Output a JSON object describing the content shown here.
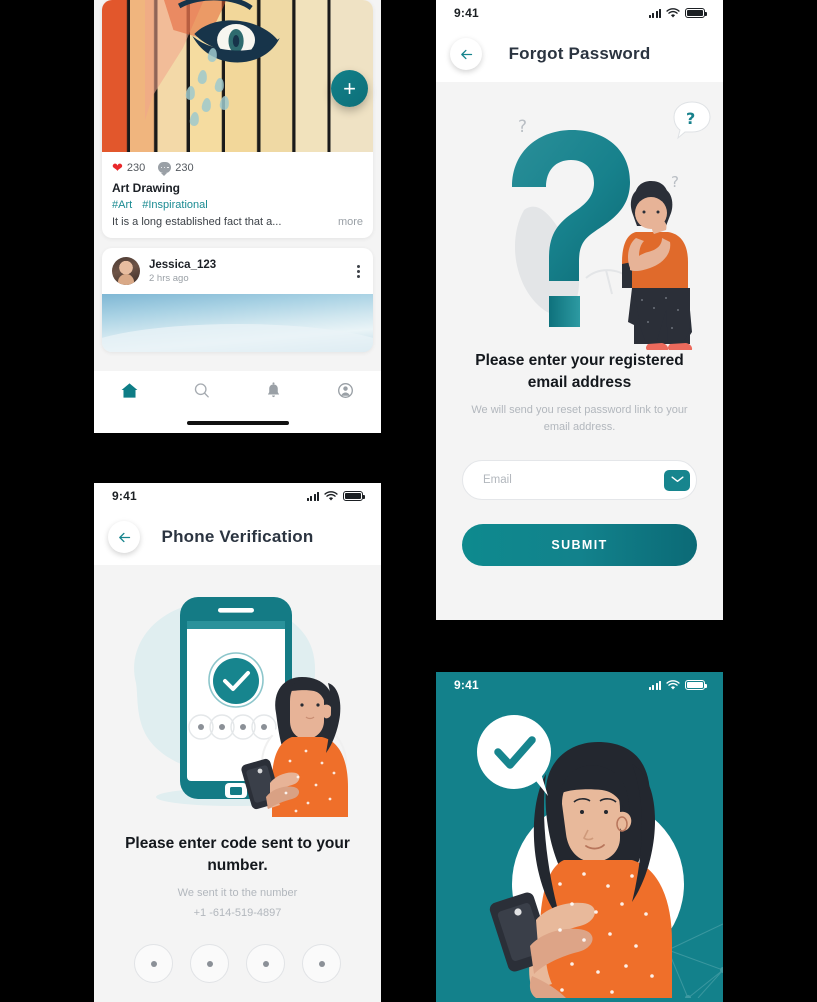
{
  "theme": {
    "teal": "#13818b",
    "teal_dark": "#0b6a76",
    "bg": "#f4f4f4",
    "heart": "#e9282b",
    "muted": "#b2b7bd"
  },
  "screens": {
    "feed": {
      "name": "social-feed",
      "post1": {
        "likes": "230",
        "comments": "230",
        "title": "Art Drawing",
        "tag1": "#Art",
        "tag2": "#Inspirational",
        "excerpt": "It is a long established fact that a...",
        "more_label": "more",
        "image_alt": "street-art-mural-on-wooden-fence"
      },
      "post2": {
        "username": "Jessica_123",
        "time": "2 hrs ago",
        "image_alt": "ocean-wave-photo"
      },
      "fab_label": "+",
      "nav": [
        {
          "icon": "home-icon",
          "active": true
        },
        {
          "icon": "search-icon",
          "active": false
        },
        {
          "icon": "bell-icon",
          "active": false
        },
        {
          "icon": "account-icon",
          "active": false
        }
      ]
    },
    "forgot": {
      "status": {
        "time": "9:41"
      },
      "title": "Forgot Password",
      "headline": "Please enter your registered email address",
      "subline": "We will send you reset password link to your email address.",
      "email_placeholder": "Email",
      "email_value": "",
      "submit_label": "SUBMIT",
      "illustration_alt": "woman-thinking-beside-large-question-mark"
    },
    "verify": {
      "status": {
        "time": "9:41"
      },
      "title": "Phone Verification",
      "headline": "Please enter code sent to your number.",
      "subline": "We sent it to the number",
      "phone": "+1 -614-519-4897",
      "otp_digits": [
        "",
        "",
        "",
        ""
      ],
      "illustration_alt": "woman-with-phone-and-verified-checkmark"
    },
    "success": {
      "status": {
        "time": "9:41"
      },
      "illustration_alt": "woman-holding-phone-with-check-speech-bubble"
    }
  }
}
